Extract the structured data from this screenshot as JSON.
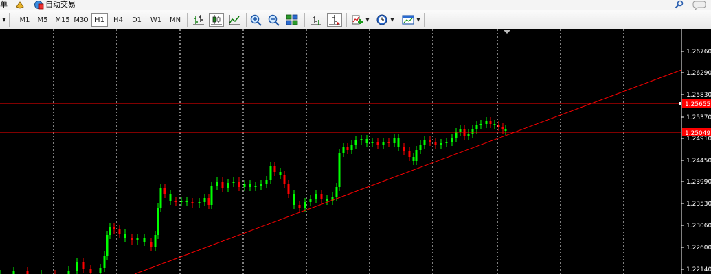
{
  "menu": {
    "item_left": "单",
    "auto_trade": "自动交易"
  },
  "toolbar": {
    "timeframes": [
      "M1",
      "M5",
      "M15",
      "M30",
      "H1",
      "H4",
      "D1",
      "W1",
      "MN"
    ],
    "active_timeframe": "H1"
  },
  "chart": {
    "background": "#000000",
    "bull_color": "#00ff00",
    "bear_color": "#ff0000",
    "line_color": "#ff0000",
    "grid": "vertical dotted",
    "horizontal_lines": [
      {
        "price_label": "1.25655",
        "color": "#ff0000"
      },
      {
        "price_label": "1.25049",
        "color": "#ff0000"
      }
    ],
    "price_ticks": [
      "1.26760",
      "1.26290",
      "1.25830",
      "1.25370",
      "1.24910",
      "1.24450",
      "1.23990",
      "1.23530",
      "1.23060",
      "1.22600",
      "1.22140"
    ]
  }
}
